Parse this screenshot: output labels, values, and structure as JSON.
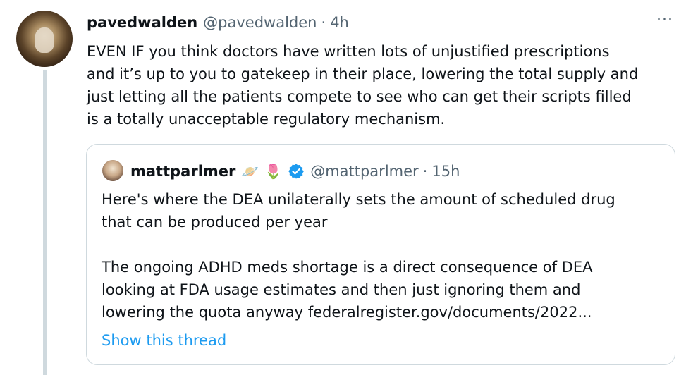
{
  "tweet": {
    "name": "pavedwalden",
    "handle": "@pavedwalden",
    "separator": "·",
    "time": "4h",
    "more_glyph": "···",
    "text": "EVEN IF you think doctors have written lots of unjustified prescriptions\nand it’s up to you to gatekeep in their place, lowering the total supply and\njust letting all the patients compete to see who can get their scripts filled\nis a totally unacceptable regulatory mechanism."
  },
  "quote": {
    "name": "mattparlmer",
    "emoji_1": "🪐",
    "emoji_2": "🌷",
    "verified_icon": "verified-badge-icon",
    "verified_color": "#1d9bf0",
    "handle": "@mattparlmer",
    "separator": "·",
    "time": "15h",
    "text": "Here's where the DEA unilaterally sets the amount of scheduled drug\nthat can be produced per year\n\nThe ongoing ADHD meds shortage is a direct consequence of DEA\nlooking at FDA usage estimates and then just ignoring them and\nlowering the quota anyway federalregister.gov/documents/2022...",
    "show_thread": "Show this thread"
  }
}
